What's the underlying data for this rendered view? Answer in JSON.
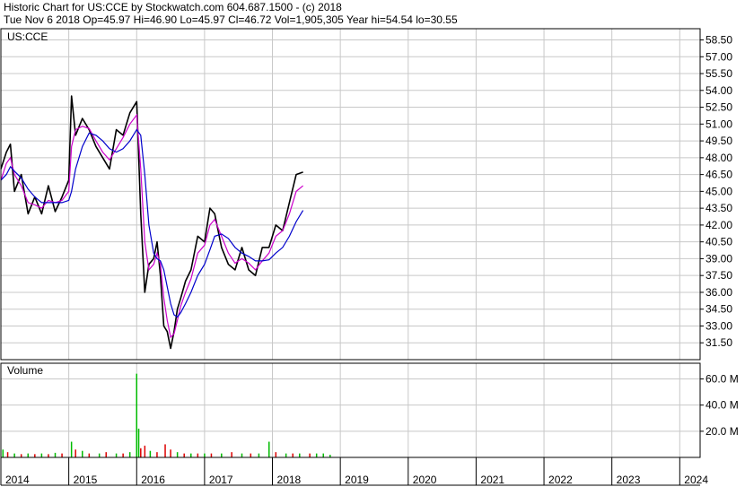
{
  "header": {
    "line1": "Historic Chart for US:CCE by Stockwatch.com 604.687.1500 - (c) 2018",
    "line2": "Tue Nov  6 2018  Op=45.97  Hi=46.90  Lo=45.97  Cl=46.72  Vol=1,905,305  Year hi=54.54  lo=30.55"
  },
  "chart_data": [
    {
      "type": "line",
      "title": "US:CCE",
      "x_ticks": [
        "2014",
        "2015",
        "2016",
        "2017",
        "2018",
        "2019",
        "2020",
        "2021",
        "2022",
        "2023",
        "2024"
      ],
      "y_ticks": [
        "58.50",
        "57.00",
        "55.50",
        "54.00",
        "52.50",
        "51.00",
        "49.50",
        "48.00",
        "46.50",
        "45.00",
        "43.50",
        "42.00",
        "40.50",
        "39.00",
        "37.50",
        "36.00",
        "34.50",
        "33.00",
        "31.50"
      ],
      "ylim": [
        30.0,
        59.5
      ],
      "xlim": [
        2014.0,
        2024.3
      ],
      "grid": true,
      "colors": {
        "price": "#000000",
        "ma_short": "#cc00cc",
        "ma_long": "#0000cc"
      },
      "series": [
        {
          "x": [
            2014.0,
            2014.08,
            2014.14,
            2014.2,
            2014.3,
            2014.4,
            2014.5,
            2014.6,
            2014.7,
            2014.8,
            2014.9,
            2015.0,
            2015.04,
            2015.1,
            2015.2,
            2015.3,
            2015.4,
            2015.5,
            2015.6,
            2015.7,
            2015.8,
            2015.9,
            2016.0,
            2016.06,
            2016.12,
            2016.18,
            2016.25,
            2016.3,
            2016.35,
            2016.4,
            2016.45,
            2016.5,
            2016.55,
            2016.6,
            2016.65,
            2016.72,
            2016.8,
            2016.9,
            2017.0,
            2017.08,
            2017.15,
            2017.25,
            2017.35,
            2017.45,
            2017.55,
            2017.65,
            2017.75,
            2017.85,
            2017.95,
            2018.05,
            2018.15,
            2018.25,
            2018.35,
            2018.45,
            2018.55,
            2018.65,
            2018.75,
            2018.85
          ]
        },
        {
          "y": [
            47.0,
            48.5,
            49.2,
            45.0,
            46.5,
            43.0,
            44.5,
            43.0,
            45.5,
            43.2,
            44.5,
            46.0,
            53.5,
            50.0,
            51.5,
            50.5,
            49.0,
            48.0,
            47.0,
            50.5,
            50.0,
            52.0,
            53.0,
            43.0,
            36.0,
            38.5,
            39.0,
            40.5,
            37.5,
            33.0,
            32.5,
            31.0,
            32.5,
            34.5,
            35.5,
            37.0,
            38.0,
            41.0,
            40.5,
            43.5,
            43.0,
            40.0,
            38.5,
            38.0,
            40.0,
            38.0,
            37.5,
            40.0,
            40.0,
            42.0,
            41.5,
            44.0,
            46.5,
            46.72
          ]
        },
        {
          "name": "",
          "y": [
            46.0,
            47.5,
            48.0,
            46.5,
            45.5,
            44.0,
            43.8,
            43.5,
            44.2,
            44.0,
            44.2,
            45.0,
            49.0,
            50.5,
            50.8,
            50.6,
            49.5,
            48.5,
            47.8,
            48.8,
            49.8,
            51.0,
            51.8,
            47.0,
            40.5,
            38.0,
            38.5,
            39.5,
            38.5,
            35.5,
            33.5,
            32.0,
            32.3,
            33.5,
            34.8,
            36.0,
            37.2,
            39.5,
            40.2,
            42.0,
            42.5,
            41.0,
            39.5,
            38.6,
            39.0,
            38.6,
            38.0,
            38.8,
            39.5,
            41.0,
            41.5,
            43.0,
            45.0,
            45.5
          ]
        },
        {
          "name": "",
          "y": [
            46.0,
            46.5,
            47.2,
            46.8,
            46.2,
            45.2,
            44.5,
            44.0,
            44.0,
            44.0,
            44.0,
            44.2,
            45.0,
            47.0,
            49.0,
            50.2,
            50.0,
            49.5,
            48.8,
            48.5,
            48.8,
            49.5,
            50.5,
            50.0,
            46.5,
            42.0,
            39.5,
            39.0,
            38.8,
            38.0,
            36.5,
            35.0,
            34.0,
            33.8,
            34.2,
            35.0,
            36.0,
            37.5,
            38.5,
            39.8,
            41.0,
            41.2,
            40.8,
            40.0,
            39.5,
            39.2,
            38.8,
            38.8,
            38.9,
            39.5,
            40.0,
            41.0,
            42.3,
            43.3
          ]
        }
      ]
    },
    {
      "type": "bar",
      "title": "Volume",
      "y_ticks": [
        "60.0 M",
        "40.0 M",
        "20.0 M"
      ],
      "ylim": [
        0,
        72
      ],
      "colors": {
        "up": "#00bb00",
        "down": "#dd0000"
      },
      "bars": [
        {
          "x": 2014.03,
          "v": 6,
          "up": true
        },
        {
          "x": 2014.1,
          "v": 4,
          "up": false
        },
        {
          "x": 2014.2,
          "v": 3,
          "up": true
        },
        {
          "x": 2014.3,
          "v": 2.5,
          "up": false
        },
        {
          "x": 2014.4,
          "v": 3,
          "up": true
        },
        {
          "x": 2014.5,
          "v": 2.5,
          "up": false
        },
        {
          "x": 2014.6,
          "v": 3,
          "up": true
        },
        {
          "x": 2014.7,
          "v": 2.5,
          "up": false
        },
        {
          "x": 2014.8,
          "v": 3.5,
          "up": true
        },
        {
          "x": 2014.9,
          "v": 3,
          "up": false
        },
        {
          "x": 2015.04,
          "v": 12,
          "up": true
        },
        {
          "x": 2015.1,
          "v": 6,
          "up": false
        },
        {
          "x": 2015.2,
          "v": 5,
          "up": true
        },
        {
          "x": 2015.3,
          "v": 3,
          "up": false
        },
        {
          "x": 2015.45,
          "v": 3,
          "up": true
        },
        {
          "x": 2015.55,
          "v": 4,
          "up": false
        },
        {
          "x": 2015.7,
          "v": 3,
          "up": true
        },
        {
          "x": 2015.8,
          "v": 3,
          "up": false
        },
        {
          "x": 2015.9,
          "v": 4,
          "up": true
        },
        {
          "x": 2016.0,
          "v": 64,
          "up": true
        },
        {
          "x": 2016.03,
          "v": 22,
          "up": true
        },
        {
          "x": 2016.06,
          "v": 7,
          "up": false
        },
        {
          "x": 2016.12,
          "v": 9,
          "up": false
        },
        {
          "x": 2016.2,
          "v": 5,
          "up": true
        },
        {
          "x": 2016.3,
          "v": 4,
          "up": false
        },
        {
          "x": 2016.42,
          "v": 10,
          "up": false
        },
        {
          "x": 2016.5,
          "v": 6,
          "up": false
        },
        {
          "x": 2016.6,
          "v": 4,
          "up": true
        },
        {
          "x": 2016.7,
          "v": 3,
          "up": false
        },
        {
          "x": 2016.8,
          "v": 3,
          "up": true
        },
        {
          "x": 2016.9,
          "v": 3,
          "up": false
        },
        {
          "x": 2017.0,
          "v": 3,
          "up": true
        },
        {
          "x": 2017.1,
          "v": 3,
          "up": false
        },
        {
          "x": 2017.25,
          "v": 3,
          "up": true
        },
        {
          "x": 2017.4,
          "v": 4,
          "up": false
        },
        {
          "x": 2017.55,
          "v": 3,
          "up": true
        },
        {
          "x": 2017.68,
          "v": 3,
          "up": false
        },
        {
          "x": 2017.8,
          "v": 3,
          "up": true
        },
        {
          "x": 2017.95,
          "v": 12,
          "up": true
        },
        {
          "x": 2018.05,
          "v": 4,
          "up": false
        },
        {
          "x": 2018.2,
          "v": 3,
          "up": true
        },
        {
          "x": 2018.3,
          "v": 3,
          "up": false
        },
        {
          "x": 2018.4,
          "v": 3,
          "up": true
        },
        {
          "x": 2018.55,
          "v": 3,
          "up": false
        },
        {
          "x": 2018.65,
          "v": 3,
          "up": true
        },
        {
          "x": 2018.75,
          "v": 3,
          "up": true
        },
        {
          "x": 2018.85,
          "v": 2,
          "up": true
        }
      ]
    }
  ]
}
